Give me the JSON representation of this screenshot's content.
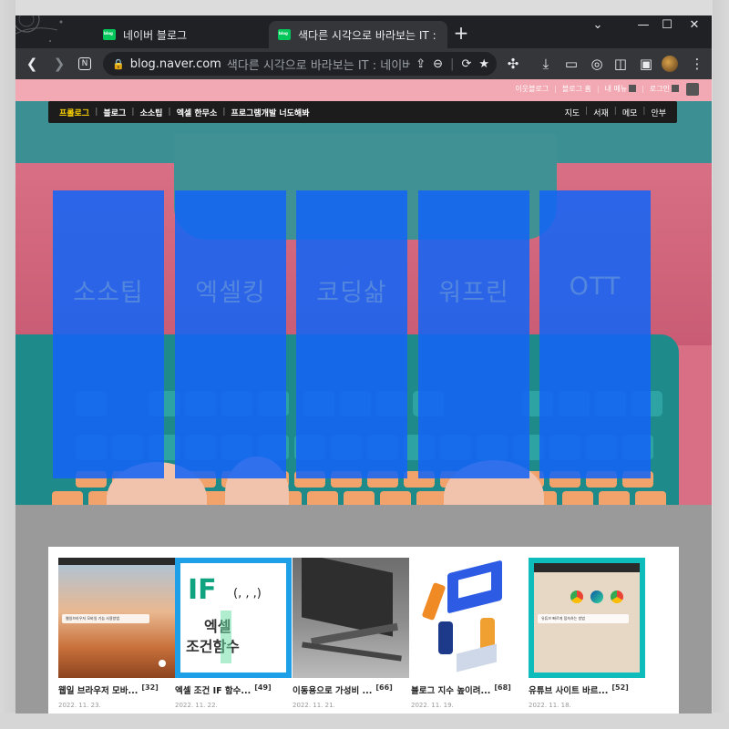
{
  "browser": {
    "tabs": [
      {
        "title": "네이버 블로그",
        "active": false
      },
      {
        "title": "색다른 시각으로 바라보는 IT : 네",
        "active": true
      }
    ],
    "url_domain": "blog.naver.com",
    "url_title": "색다른 시각으로 바라보는 IT : 네이버",
    "favicon_text": "blog",
    "window_controls": {
      "minimize": "—",
      "maximize": "☐",
      "close": "✕"
    }
  },
  "blog": {
    "util_links": [
      "이웃블로그",
      "블로그 홈",
      "내 메뉴",
      "로그인"
    ],
    "nav_items": [
      "프롤로그",
      "블로그",
      "소소팁",
      "엑셀 한무소",
      "프로그램개발 너도해봐"
    ],
    "nav_right": [
      "지도",
      "서재",
      "메모",
      "안부"
    ],
    "categories": [
      "소소팁",
      "엑셀킹",
      "코딩삶",
      "워프린",
      "OTT"
    ]
  },
  "posts": [
    {
      "title": "웹일 브라우저 모바...",
      "count": "[32]",
      "date": "2022. 11. 23.",
      "thumb_caption": "웹일브라우저 모바일 기능 사용방법"
    },
    {
      "title": "엑셀 조건 IF 함수...",
      "count": "[49]",
      "date": "2022. 11. 22.",
      "thumb_caption": "IF(, , ,) 엑셀 조건함수"
    },
    {
      "title": "이동용으로 가성비 ...",
      "count": "[66]",
      "date": "2022. 11. 21.",
      "thumb_caption": ""
    },
    {
      "title": "블로그 지수 높이려...",
      "count": "[68]",
      "date": "2022. 11. 19.",
      "thumb_caption": ""
    },
    {
      "title": "유튜브 사이트 바르...",
      "count": "[52]",
      "date": "2022. 11. 18.",
      "thumb_caption": "유튜브 빠르게 접속하는 방법"
    }
  ],
  "colors": {
    "overlay": "#1464f5",
    "hero_pink": "#d86f84",
    "teal": "#3c8f92",
    "nav_active": "#ffd400"
  }
}
